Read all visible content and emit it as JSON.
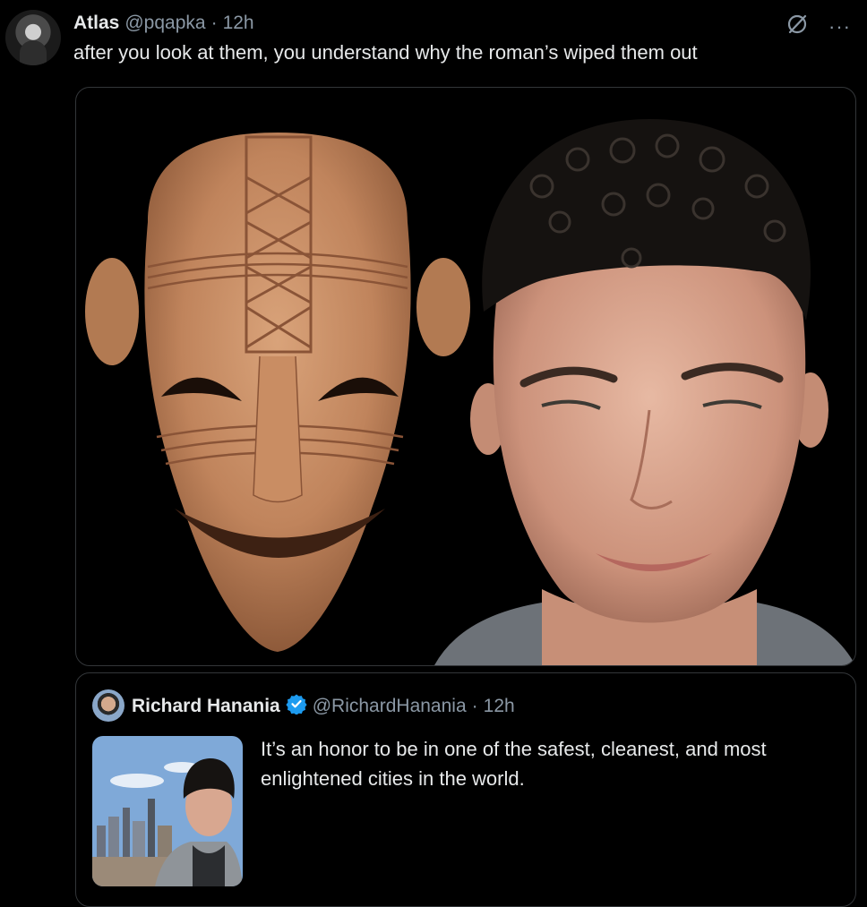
{
  "tweet": {
    "author_name": "Atlas",
    "handle": "@pqapka",
    "separator": "·",
    "time": "12h",
    "text": "after you look at them, you understand why the roman’s wiped them out",
    "icons": [
      "grok-icon",
      "more-icon"
    ],
    "more_label": "···"
  },
  "media": {
    "panels": [
      "carved-terracotta-mask",
      "smiling-man-portrait"
    ]
  },
  "quoted_tweet": {
    "author_name": "Richard Hanania",
    "verified": true,
    "handle": "@RichardHanania",
    "separator": "·",
    "time": "12h",
    "text": "It’s an honor to be in one of the safest, cleanest, and most enlightened cities in the world."
  },
  "colors": {
    "background": "#000000",
    "text": "#e7e9ea",
    "muted": "#8b98a5",
    "border": "#333639",
    "verified": "#1d9bf0"
  }
}
